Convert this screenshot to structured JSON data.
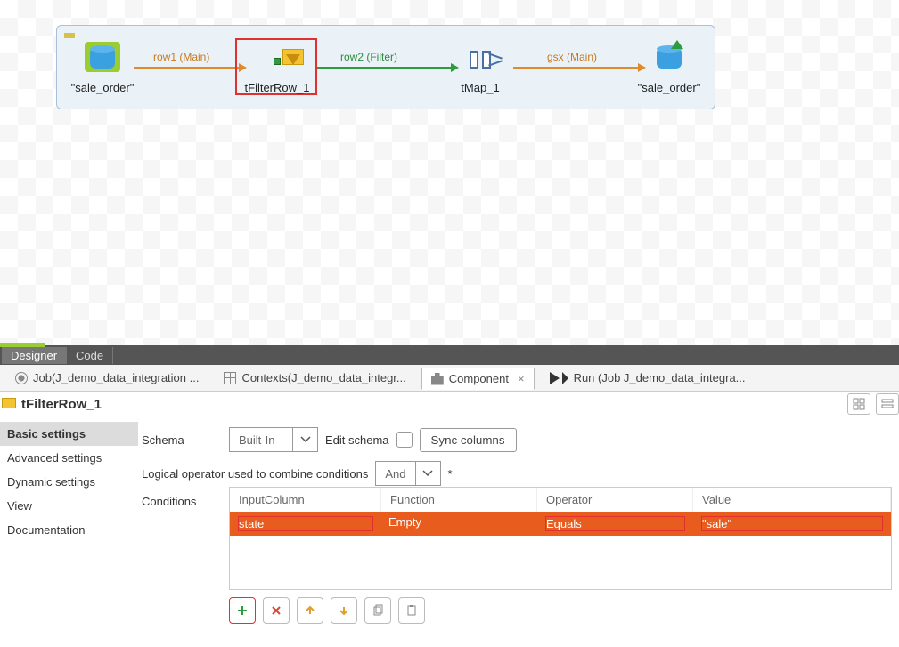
{
  "canvas": {
    "nodes": {
      "sale_order_in": {
        "label": "\"sale_order\""
      },
      "tfilterrow": {
        "label": "tFilterRow_1"
      },
      "tmap": {
        "label": "tMap_1"
      },
      "sale_order_out": {
        "label": "\"sale_order\""
      }
    },
    "connections": {
      "row1": "row1 (Main)",
      "row2": "row2 (Filter)",
      "gsx": "gsx (Main)"
    }
  },
  "mode_tabs": {
    "designer": "Designer",
    "code": "Code"
  },
  "bottom_tabs": {
    "job": "Job(J_demo_data_integration ...",
    "contexts": "Contexts(J_demo_data_integr...",
    "component": "Component",
    "run": "Run (Job J_demo_data_integra..."
  },
  "component": {
    "title": "tFilterRow_1",
    "nav": {
      "basic": "Basic settings",
      "advanced": "Advanced settings",
      "dynamic": "Dynamic settings",
      "view": "View",
      "doc": "Documentation"
    },
    "schema": {
      "label": "Schema",
      "value": "Built-In",
      "edit_label": "Edit schema",
      "sync_label": "Sync columns"
    },
    "logical": {
      "label": "Logical operator used to combine conditions",
      "value": "And"
    },
    "conditions": {
      "label": "Conditions",
      "headers": {
        "input": "InputColumn",
        "func": "Function",
        "op": "Operator",
        "val": "Value"
      },
      "row": {
        "input": "state",
        "func": "Empty",
        "op": "Equals",
        "val": "\"sale\""
      }
    }
  }
}
